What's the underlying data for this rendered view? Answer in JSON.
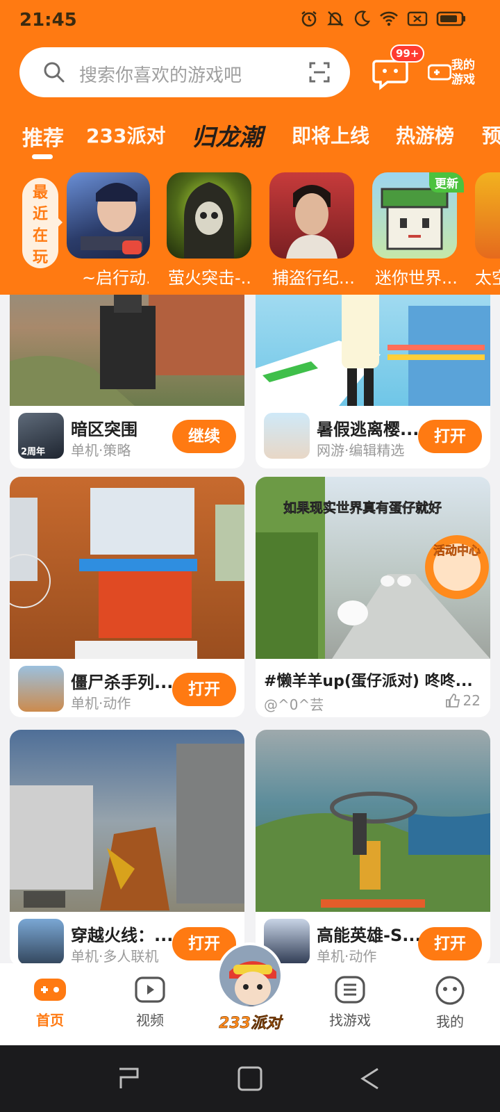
{
  "status_bar": {
    "time": "21:45"
  },
  "header": {
    "search_placeholder": "搜索你喜欢的游戏吧",
    "message_badge": "99+",
    "my_games_label": "我的游戏",
    "tabs": [
      {
        "label": "推荐",
        "active": true
      },
      {
        "label": "233派对"
      },
      {
        "label": "归龙潮",
        "logo": true
      },
      {
        "label": "即将上线"
      },
      {
        "label": "热游榜"
      },
      {
        "label": "预"
      }
    ]
  },
  "recent": {
    "label": "最近在玩",
    "games": [
      {
        "name": "~启行动..."
      },
      {
        "name": "萤火突击-..."
      },
      {
        "name": "捕盗行纪..."
      },
      {
        "name": "迷你世界...",
        "badge": "更新"
      },
      {
        "name": "太空"
      }
    ]
  },
  "feed": {
    "cards": [
      {
        "type": "game",
        "title": "暗区突围",
        "subtitle": "单机·策略",
        "button": "继续",
        "thumb_text": "2周年"
      },
      {
        "type": "game",
        "title": "暑假逃离樱...",
        "subtitle": "网游·编辑精选",
        "button": "打开"
      },
      {
        "type": "game",
        "title": "僵尸杀手列...",
        "subtitle": "单机·动作",
        "button": "打开"
      },
      {
        "type": "video",
        "title": "#懒羊羊up(蛋仔派对) 咚咚...",
        "author": "@^0^芸",
        "likes": "22",
        "overlay_text": "如果现实世界真有蛋仔就好",
        "event_badge": "活动中心"
      },
      {
        "type": "game",
        "title": "穿越火线：...",
        "subtitle": "单机·多人联机",
        "button": "打开"
      },
      {
        "type": "game",
        "title": "高能英雄-S...",
        "subtitle": "单机·动作",
        "button": "打开"
      }
    ]
  },
  "bottom_nav": {
    "items": [
      {
        "label": "首页",
        "active": true
      },
      {
        "label": "视频"
      },
      {
        "label": "233派对"
      },
      {
        "label": "找游戏"
      },
      {
        "label": "我的"
      }
    ]
  },
  "colors": {
    "accent": "#ff7a12",
    "badge_red": "#ff3b30",
    "update_green": "#4cc23e"
  }
}
